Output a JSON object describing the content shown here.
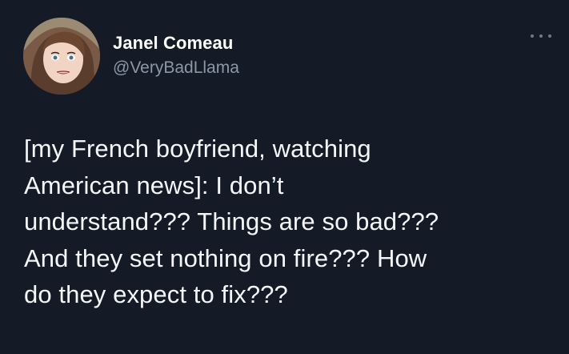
{
  "tweet": {
    "author": {
      "display_name": "Janel Comeau",
      "handle": "@VeryBadLlama",
      "avatar_icon": "profile-photo"
    },
    "more_icon": "more-options-icon",
    "text": "[my French boyfriend, watching\nAmerican news]: I don’t\nunderstand??? Things are so bad???\nAnd they set nothing on fire??? How\ndo they expect to fix???"
  },
  "colors": {
    "background": "#141b27",
    "text": "#f4f6f8",
    "secondary_text": "#8b98a5"
  }
}
